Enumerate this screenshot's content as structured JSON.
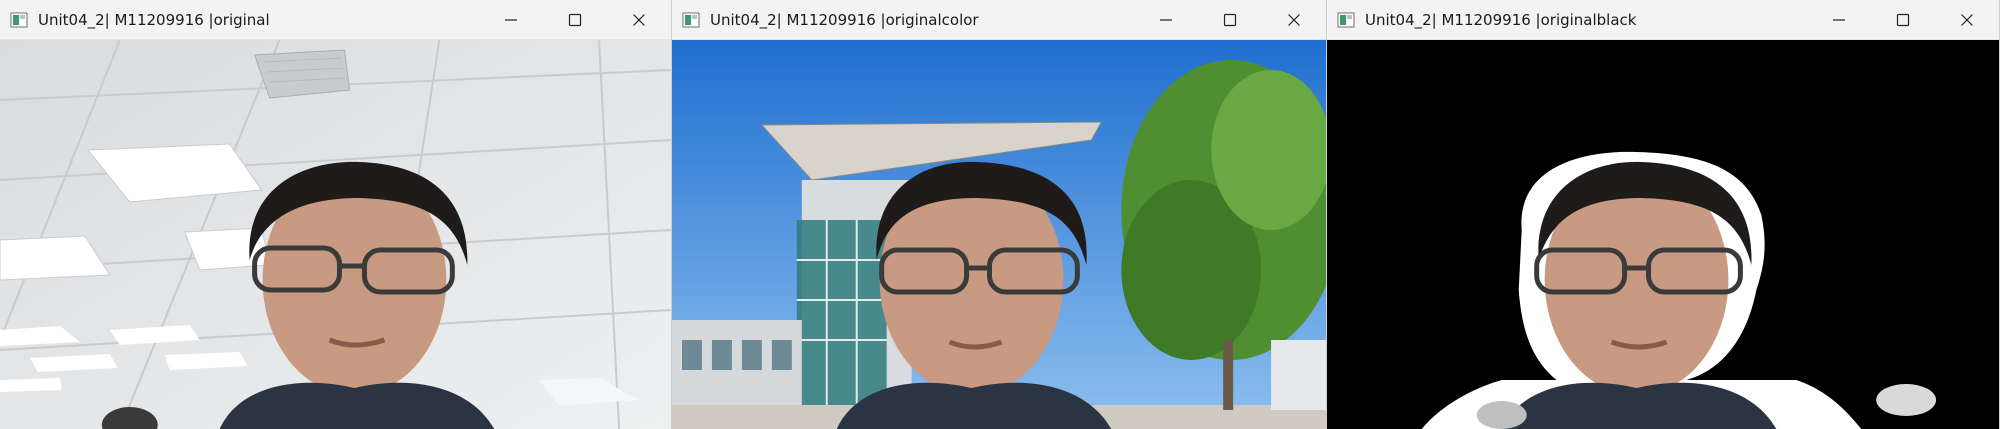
{
  "windows": [
    {
      "title": "Unit04_2| M11209916 |original",
      "variant": "office-background",
      "background_color": "#e4e7ea"
    },
    {
      "title": "Unit04_2| M11209916 |originalcolor",
      "variant": "outdoor-building-background",
      "background_color": "#3a86d6"
    },
    {
      "title": "Unit04_2| M11209916 |originalblack",
      "variant": "black-background",
      "background_color": "#000000"
    }
  ],
  "controls": {
    "minimize_icon": "minimize-icon",
    "maximize_icon": "maximize-icon",
    "close_icon": "close-icon"
  },
  "colors": {
    "titlebar": "#f3f3f3",
    "title_text": "#1a1a1a"
  }
}
